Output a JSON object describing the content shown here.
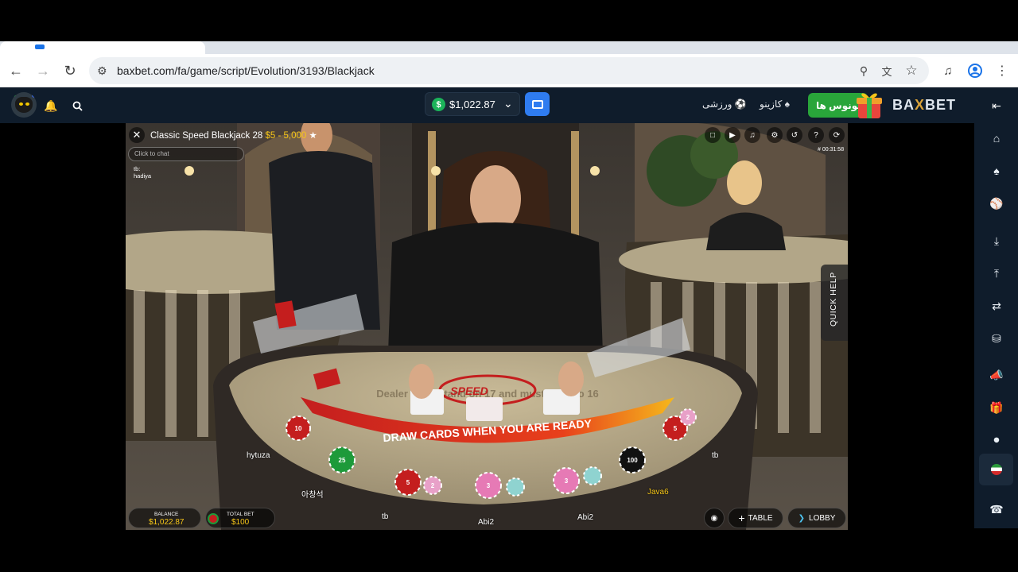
{
  "browser": {
    "url": "baxbet.com/fa/game/script/Evolution/3193/Blackjack"
  },
  "site": {
    "balance": "$1,022.87",
    "nav_sports": "ورزشی",
    "nav_casino": "کازینو",
    "bonus_label": "بونوس ها",
    "brand_pre": "BA",
    "brand_x": "X",
    "brand_post": "BET"
  },
  "game": {
    "title": "Classic Speed Blackjack 28",
    "limits": "$5 - 5,000",
    "game_id": "# 00:31:58",
    "chat_placeholder": "Click to chat",
    "chat_user": "tb:",
    "chat_text": "hadiya",
    "quick_help": "QUICK HELP",
    "table_text_speed": "SPEED",
    "table_text_rule": "Dealer must stand on 17 and must draw to 16",
    "table_text_draw": "DRAW CARDS WHEN YOU ARE READY",
    "players": {
      "p1": "hytuza",
      "p2": "아창석",
      "p3": "tb",
      "p4": "Abi2",
      "p5": "Abi2",
      "p6": "Java6",
      "p7": "tb"
    },
    "balance_label": "BALANCE",
    "balance_value": "$1,022.87",
    "total_bet_label": "TOTAL BET",
    "total_bet_value": "$100",
    "table_btn": "TABLE",
    "lobby_btn": "LOBBY",
    "chips": [
      "10",
      "25",
      "5",
      "2",
      "3",
      "100",
      "5",
      "2"
    ]
  },
  "colors": {
    "header_bg": "#0f1c2b",
    "bonus_green": "#29a53a",
    "accent_blue": "#2f7cf0",
    "gold": "#f5c518"
  }
}
